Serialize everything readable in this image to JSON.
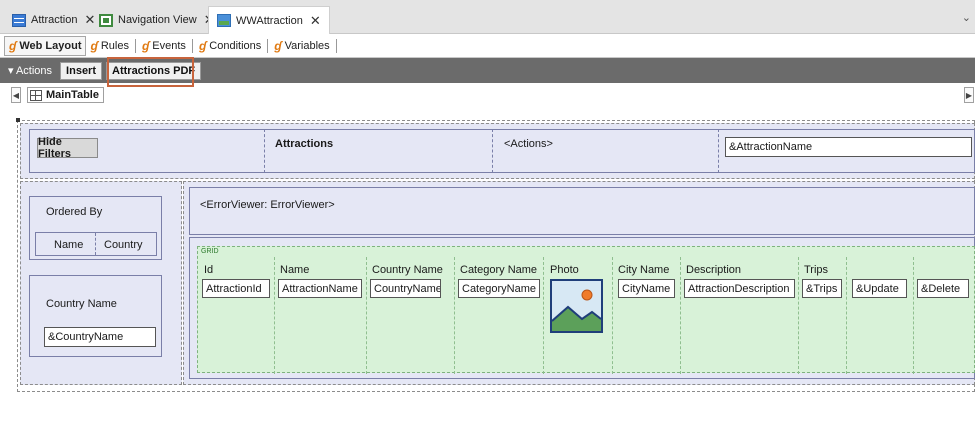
{
  "doc_tabs": [
    {
      "label": "Attraction",
      "close": "✕"
    },
    {
      "label": "Navigation View",
      "close": "✕"
    },
    {
      "label": "WWAttraction",
      "close": "✕"
    }
  ],
  "editor_tabs": [
    {
      "label": "Web Layout"
    },
    {
      "label": "Rules"
    },
    {
      "label": "Events"
    },
    {
      "label": "Conditions"
    },
    {
      "label": "Variables"
    }
  ],
  "actions_bar": {
    "label": "▾ Actions",
    "insert": "Insert",
    "attractions_pdf": "Attractions PDF"
  },
  "breadcrumb": {
    "main_table": "MainTable"
  },
  "header": {
    "hide_filters": "Hide Filters",
    "title": "Attractions",
    "actions": "<Actions>",
    "search_field": "&AttractionName"
  },
  "filters": {
    "ordered_by": "Ordered By",
    "order_options": [
      "Name",
      "Country"
    ],
    "country_name_label": "Country Name",
    "country_name_field": "&CountryName"
  },
  "error_viewer": "<ErrorViewer: ErrorViewer>",
  "grid": {
    "title": "GRID",
    "columns": [
      {
        "header": "Id",
        "field": "AttractionId"
      },
      {
        "header": "Name",
        "field": "AttractionName"
      },
      {
        "header": "Country Name",
        "field": "CountryName"
      },
      {
        "header": "Category Name",
        "field": "CategoryName"
      },
      {
        "header": "Photo",
        "field": ""
      },
      {
        "header": "City Name",
        "field": "CityName"
      },
      {
        "header": "Description",
        "field": "AttractionDescription"
      },
      {
        "header": "Trips",
        "field": "&Trips"
      },
      {
        "header": "",
        "field": "&Update"
      },
      {
        "header": "",
        "field": "&Delete"
      }
    ]
  }
}
